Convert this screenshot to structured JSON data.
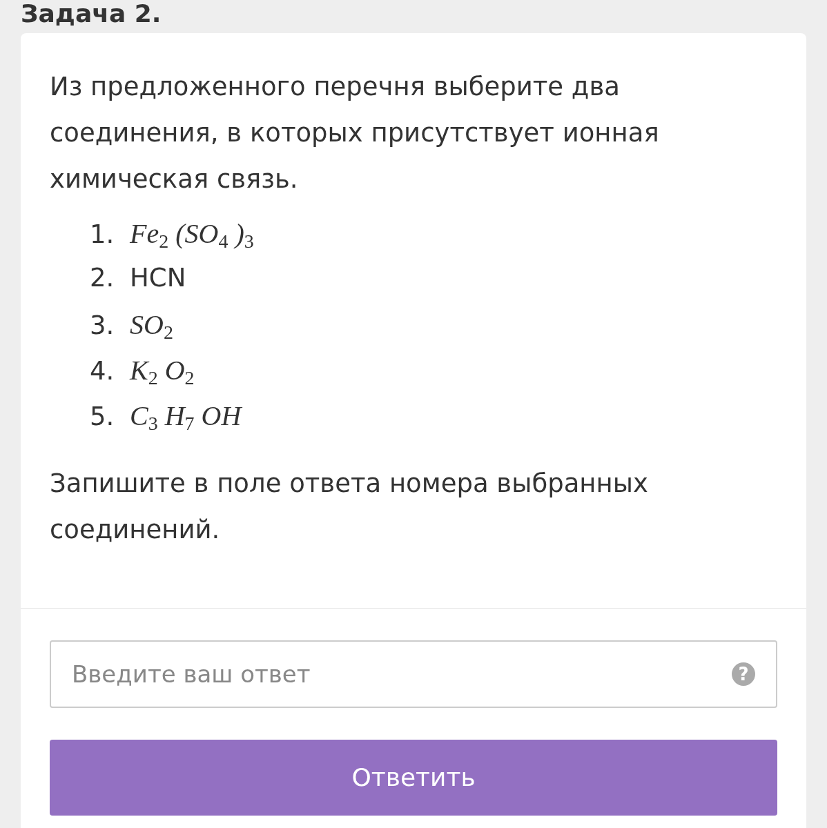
{
  "task_title": "Задача 2.",
  "question": "Из предложенного перечня выберите два соединения, в которых присутствует ионная химическая связь.",
  "options": [
    {
      "number": "1.",
      "kind": "formula",
      "text": "Fe$_{2}$ (SO$_{4}$ )$_{3}$"
    },
    {
      "number": "2.",
      "kind": "text",
      "text": "HCN"
    },
    {
      "number": "3.",
      "kind": "formula",
      "text": "SO$_{2}$"
    },
    {
      "number": "4.",
      "kind": "formula",
      "text": "K$_{2}$ O$_{2}$"
    },
    {
      "number": "5.",
      "kind": "formula",
      "text": "C$_{3}$ H$_{7}$ OH"
    }
  ],
  "instruction": "Запишите в поле ответа номера выбранных соединений.",
  "answer": {
    "placeholder": "Введите ваш ответ",
    "help": "?"
  },
  "submit_button": "Ответить"
}
